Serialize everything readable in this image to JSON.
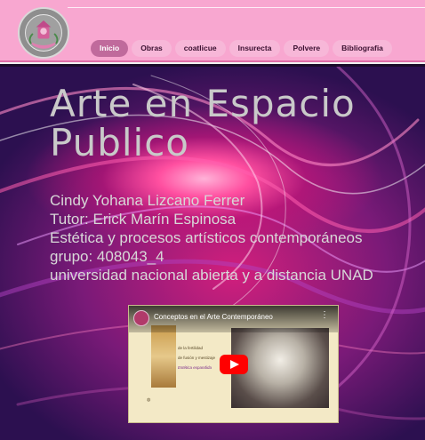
{
  "nav": {
    "items": [
      {
        "label": "Inicio"
      },
      {
        "label": "Obras"
      },
      {
        "label": "coatlicue"
      },
      {
        "label": "Insurecta"
      },
      {
        "label": "Polvere"
      },
      {
        "label": "Bibliografia"
      }
    ],
    "active_index": 0
  },
  "hero": {
    "title_line1": "Arte en Espacio",
    "title_line2": "Publico",
    "info": [
      "Cindy Yohana Lizcano Ferrer",
      "Tutor: Erick Marín Espinosa",
      "Estética y procesos artísticos contemporáneos",
      "grupo: 408043_4",
      "universidad nacional abierta y a distancia UNAD"
    ]
  },
  "video": {
    "title": "Conceptos en el Arte Contemporáneo",
    "doc_lines": [
      "de la fertilidad",
      "de fusión y mestizaje",
      "Estética expandida"
    ]
  },
  "colors": {
    "header_bg": "#f8a7d0",
    "nav_active": "#c06a9c",
    "nav_pill": "#f7b7d8",
    "hero_accent": "#d21f7c"
  }
}
